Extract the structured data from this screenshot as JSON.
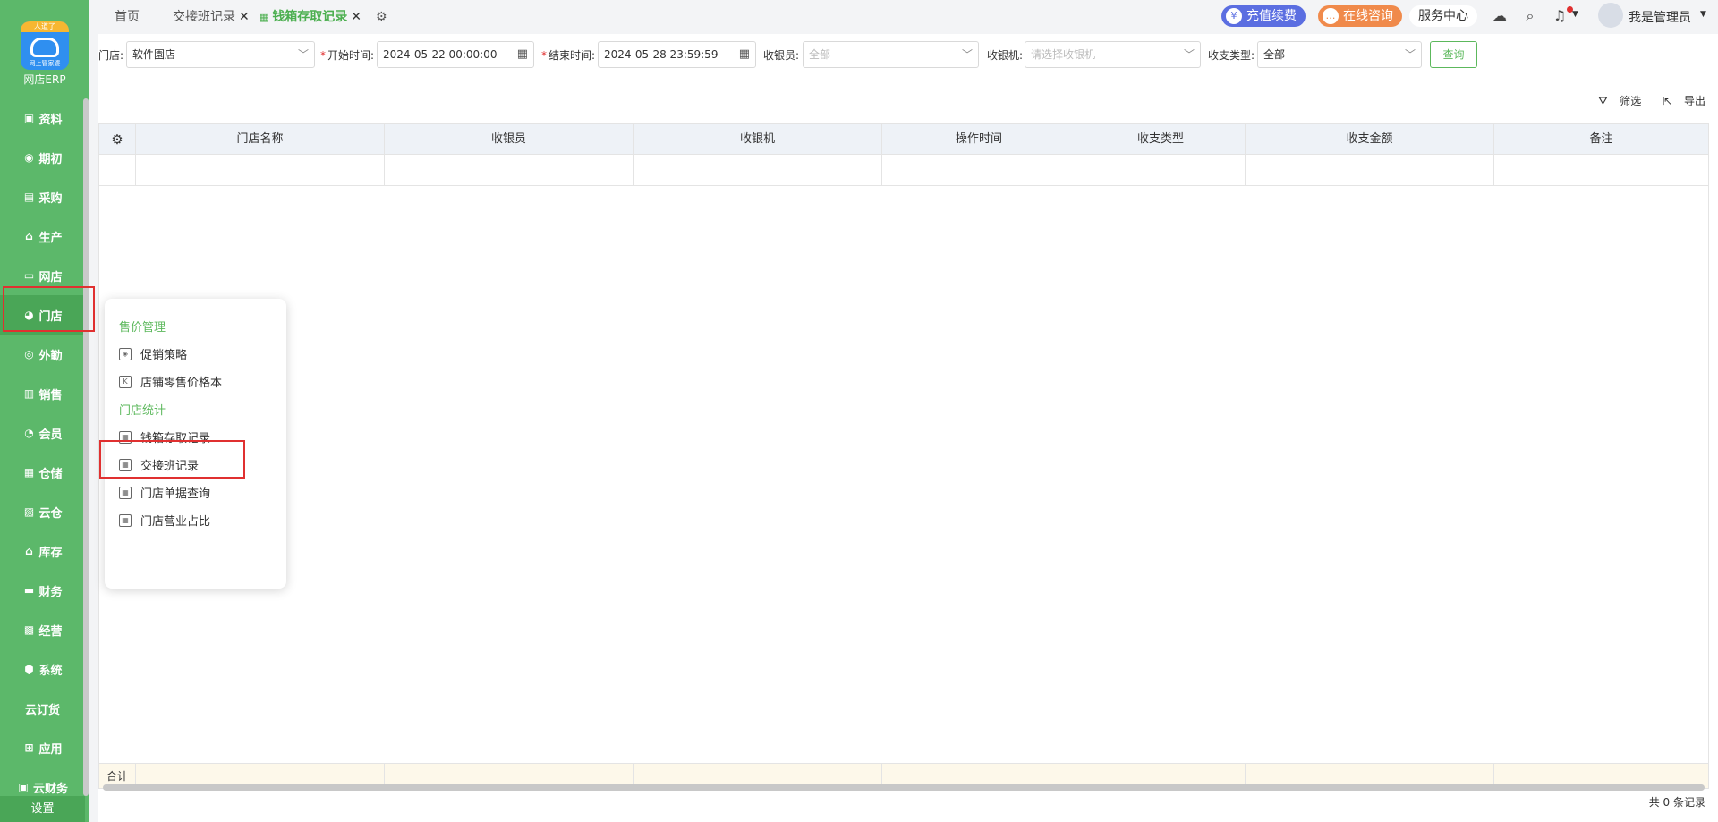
{
  "sidebar": {
    "logo_badge": "人道了",
    "logo_sub": "网上管家婆",
    "brand": "网店ERP",
    "items": [
      {
        "label": "资料",
        "icon": "user-card-icon"
      },
      {
        "label": "期初",
        "icon": "clock-icon"
      },
      {
        "label": "采购",
        "icon": "purchase-icon"
      },
      {
        "label": "生产",
        "icon": "factory-icon"
      },
      {
        "label": "网店",
        "icon": "shop-icon"
      },
      {
        "label": "门店",
        "icon": "pie-icon"
      },
      {
        "label": "外勤",
        "icon": "field-icon"
      },
      {
        "label": "销售",
        "icon": "chart-icon"
      },
      {
        "label": "会员",
        "icon": "member-icon"
      },
      {
        "label": "仓储",
        "icon": "warehouse-icon"
      },
      {
        "label": "云仓",
        "icon": "cloud-warehouse-icon"
      },
      {
        "label": "库存",
        "icon": "inventory-icon"
      },
      {
        "label": "财务",
        "icon": "finance-icon"
      },
      {
        "label": "经营",
        "icon": "business-icon"
      },
      {
        "label": "系统",
        "icon": "system-icon"
      },
      {
        "label": "云订货",
        "icon": ""
      },
      {
        "label": "应用",
        "icon": "plus-icon"
      },
      {
        "label": "云财务",
        "icon": "cloud-finance-icon"
      }
    ],
    "settings": "设置"
  },
  "tabs": {
    "home": "首页",
    "shift": "交接班记录",
    "active": "钱箱存取记录"
  },
  "topbar": {
    "recharge": "充值续费",
    "consult": "在线咨询",
    "service": "服务中心",
    "user": "我是管理员"
  },
  "filters": {
    "store_label": "门店:",
    "store_value": "软件園店",
    "start_label": "开始时间:",
    "start_value": "2024-05-22 00:00:00",
    "end_label": "结束时间:",
    "end_value": "2024-05-28 23:59:59",
    "cashier_label": "收银员:",
    "cashier_value": "全部",
    "register_label": "收银机:",
    "register_placeholder": "请选择收银机",
    "type_label": "收支类型:",
    "type_value": "全部",
    "query": "查询"
  },
  "actions": {
    "filter": "筛选",
    "export": "导出"
  },
  "table": {
    "columns": [
      "门店名称",
      "收银员",
      "收银机",
      "操作时间",
      "收支类型",
      "收支金额",
      "备注"
    ],
    "footer_label": "合计",
    "total": "共 0 条记录"
  },
  "popup": {
    "group1": "售价管理",
    "item1": "促销策略",
    "item2": "店铺零售价格本",
    "group2": "门店统计",
    "item3": "钱箱存取记录",
    "item4": "交接班记录",
    "item5": "门店单据查询",
    "item6": "门店营业占比"
  },
  "colors": {
    "brand_green": "#5cb86a",
    "recharge": "#5b6ee1",
    "consult": "#f08a4b",
    "highlight": "#e03030"
  }
}
